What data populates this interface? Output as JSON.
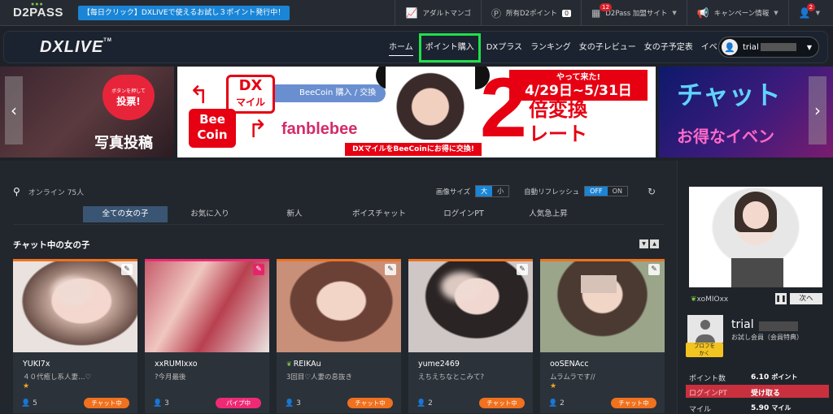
{
  "topbar": {
    "logo": "D2PASS",
    "promo": "【毎日クリック】DXLIVEで使えるお試し３ポイント発行中！",
    "items": [
      {
        "label": "アダルトマンゴ",
        "icon": "chart-icon"
      },
      {
        "label": "所有D2ポイント",
        "badge": "0",
        "icon": "coin-icon"
      },
      {
        "label": "D2Pass 加盟サイト",
        "badge": "12",
        "icon": "grid-icon"
      },
      {
        "label": "キャンペーン情報",
        "icon": "megaphone-icon"
      },
      {
        "label": "",
        "badge": "2",
        "icon": "user-icon"
      }
    ]
  },
  "nav": {
    "logo": "DXLIVE",
    "logo_tm": "TM",
    "links": [
      "ホーム",
      "ポイント購入",
      "DXプラス",
      "ランキング",
      "女の子レビュー",
      "女の子予定表",
      "イベント情報"
    ],
    "user": "trial",
    "highlight_color": "#20e04a"
  },
  "banners": {
    "left": {
      "heart_small": "ボタンを押して",
      "heart_big": "投票!",
      "title": "写真投稿"
    },
    "main": {
      "dx": "DX",
      "mile": "マイル",
      "bee": "Bee",
      "coin": "Coin",
      "pill": "BeeCoin 購入 / 交換",
      "fanble": "fanblebee",
      "strip": "DXマイルをBeeCoinにお得に交換!",
      "date_top": "やって来た!",
      "date": "4/29日~5/31日",
      "big": "2",
      "kanji1": "倍変換",
      "kanji2": "レート"
    },
    "right": {
      "t1": "チャット",
      "t2": "お得なイベン"
    }
  },
  "toolbar": {
    "online_label": "オンライン",
    "online_count": "75人",
    "image_size_label": "画像サイズ",
    "size_large": "大",
    "size_small": "小",
    "auto_refresh_label": "自動リフレッシュ",
    "off": "OFF",
    "on": "ON"
  },
  "filters": [
    "全ての女の子",
    "お気に入り",
    "新人",
    "ボイスチャット",
    "ログインPT",
    "人気急上昇"
  ],
  "section": {
    "title": "チャット中の女の子"
  },
  "cards": [
    {
      "name": "YUKI7x",
      "msg": "４０代癒し系人妻…♡",
      "star": "★",
      "count": "5",
      "status": "チャット中",
      "status_type": "chat",
      "bar": "#f0711e",
      "leaf": false
    },
    {
      "name": "xxRUMIxxo",
      "msg": "?今月最後",
      "star": "",
      "count": "3",
      "status": "パイプ中",
      "status_type": "pipe",
      "bar": "#ef2a74",
      "leaf": false
    },
    {
      "name": "REIKAu",
      "msg": "3回目♡人妻の息抜き",
      "star": "",
      "count": "3",
      "status": "チャット中",
      "status_type": "chat",
      "bar": "#f0711e",
      "leaf": true
    },
    {
      "name": "yume2469",
      "msg": "えちえちなとこみて?",
      "star": "",
      "count": "2",
      "status": "チャット中",
      "status_type": "chat",
      "bar": "#f0711e",
      "leaf": false
    },
    {
      "name": "ooSENAcc",
      "msg": "ムラムラです//",
      "star": "★",
      "count": "2",
      "status": "チャット中",
      "status_type": "chat",
      "bar": "#f0711e",
      "leaf": false
    }
  ],
  "sidebar": {
    "featured_user": "xoMIOxx",
    "next": "次へ",
    "profile_btn": "プロフを\nかく",
    "name": "trial",
    "member": "お試し会員（会員特典）",
    "stats": [
      {
        "key": "ポイント数",
        "value": "6.10",
        "unit": "ポイント"
      },
      {
        "key": "ログインPT",
        "value": "受け取る",
        "unit": ""
      },
      {
        "key": "マイル",
        "value": "5.90",
        "unit": "マイル"
      }
    ]
  }
}
